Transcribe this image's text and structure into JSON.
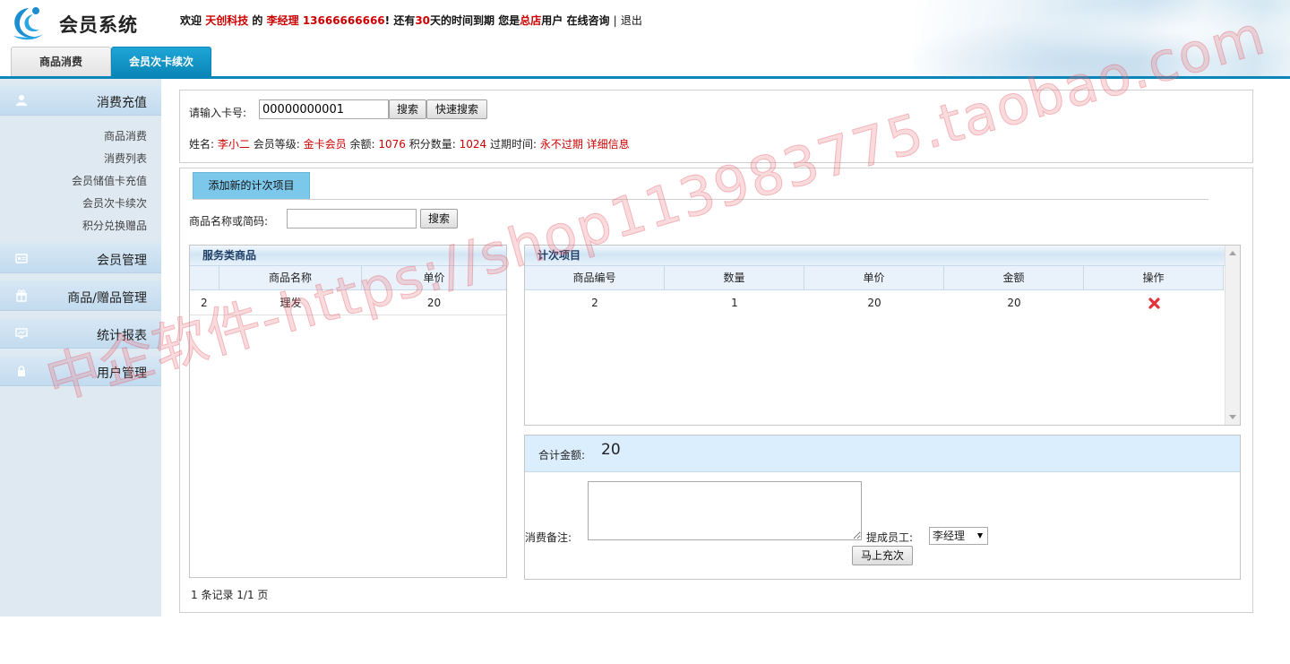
{
  "header": {
    "app_title": "会员系统",
    "welcome": {
      "w1": "欢迎",
      "company": "天创科技",
      "w2": "的",
      "user": "李经理",
      "phone": "13666666666",
      "w3": "! 还有",
      "days": "30",
      "w4": "天的时间到期 您是",
      "store": "总店",
      "w5": "用户",
      "consult": "在线咨询",
      "sep": "|",
      "logout": "退出"
    },
    "tabs": [
      {
        "label": "商品消费",
        "active": false
      },
      {
        "label": "会员次卡续次",
        "active": true
      }
    ],
    "accent": "#0a86b8"
  },
  "sidebar": {
    "groups": [
      {
        "label": "消费充值",
        "icon": "user-icon"
      },
      {
        "label": "会员管理",
        "icon": "id-card-icon"
      },
      {
        "label": "商品/赠品管理",
        "icon": "gift-icon"
      },
      {
        "label": "统计报表",
        "icon": "monitor-icon"
      },
      {
        "label": "用户管理",
        "icon": "lock-icon"
      }
    ],
    "sub_items": [
      "商品消费",
      "消费列表",
      "会员储值卡充值",
      "会员次卡续次",
      "积分兑换赠品"
    ]
  },
  "card_search": {
    "label": "请输入卡号:",
    "value": "00000000001",
    "search_btn": "搜索",
    "quick_search_btn": "快速搜索"
  },
  "member_info": {
    "name_label": "姓名:",
    "name": "李小二",
    "level_label": "会员等级:",
    "level": "金卡会员",
    "balance_label": "余额:",
    "balance": "1076",
    "points_label": "积分数量:",
    "points": "1024",
    "expire_label": "过期时间:",
    "expire": "永不过期",
    "detail_link": "详细信息"
  },
  "content": {
    "subtab": "添加新的计次项目",
    "product_search_label": "商品名称或简码:",
    "product_search_value": "",
    "product_search_btn": "搜索"
  },
  "service_grid": {
    "title": "服务类商品",
    "columns": [
      "",
      "商品名称",
      "单价"
    ],
    "rows": [
      {
        "no": "2",
        "name": "理发",
        "price": "20"
      }
    ]
  },
  "items_grid": {
    "title": "计次项目",
    "columns": [
      "商品编号",
      "数量",
      "单价",
      "金额",
      "操作"
    ],
    "rows": [
      {
        "code": "2",
        "qty": "1",
        "price": "20",
        "amount": "20",
        "action_icon": "delete-icon"
      }
    ]
  },
  "summary": {
    "total_label": "合计金额:",
    "total": "20",
    "remark_label": "消费备注:",
    "remark_value": "",
    "staff_label": "提成员工:",
    "staff_selected": "李经理",
    "submit_btn": "马上充次"
  },
  "pagination": {
    "text": "1 条记录 1/1 页"
  },
  "watermark": "中企软件-https://shop113983775.taobao.com"
}
